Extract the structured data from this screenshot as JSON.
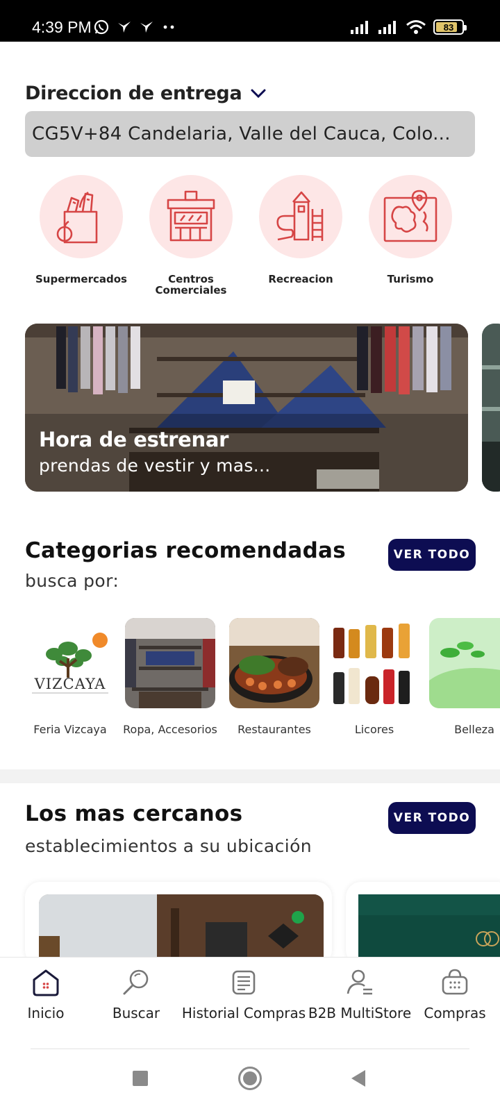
{
  "status_bar": {
    "time": "4:39 PM",
    "battery": "83",
    "icons": [
      "whatsapp-icon",
      "bird-icon",
      "bird-icon",
      "dots-icon",
      "signal-icon",
      "signal-icon",
      "wifi-icon",
      "battery-icon"
    ]
  },
  "delivery": {
    "title": "Direccion de entrega",
    "address": "CG5V+84 Candelaria, Valle del Cauca, Colo..."
  },
  "quick_categories": [
    {
      "label": "Supermercados",
      "icon": "grocery-bag-icon"
    },
    {
      "label": "Centros Comerciales",
      "icon": "storefront-icon"
    },
    {
      "label": "Recreacion",
      "icon": "playground-icon"
    },
    {
      "label": "Turismo",
      "icon": "map-pin-icon"
    }
  ],
  "banner": {
    "title": "Hora de estrenar",
    "subtitle": "prendas de vestir y mas..."
  },
  "recommended": {
    "title": "Categorias recomendadas",
    "subtitle": "busca por:",
    "button": "VER TODO",
    "logo_text": "VIZCAYA",
    "items": [
      {
        "label": "Feria Vizcaya"
      },
      {
        "label": "Ropa, Accesorios"
      },
      {
        "label": "Restaurantes"
      },
      {
        "label": "Licores"
      },
      {
        "label": "Belleza"
      }
    ]
  },
  "nearby": {
    "title": "Los mas cercanos",
    "subtitle": "establecimientos a su ubicación",
    "button": "VER TODO"
  },
  "bottom_nav": [
    {
      "label": "Inicio",
      "icon": "home-icon"
    },
    {
      "label": "Buscar",
      "icon": "search-icon"
    },
    {
      "label": "Historial Compras",
      "icon": "receipt-icon"
    },
    {
      "label": "B2B MultiStore",
      "icon": "user-list-icon"
    },
    {
      "label": "Compras",
      "icon": "basket-icon"
    }
  ],
  "colors": {
    "accent": "#d64545",
    "accent_soft": "#fde6e6",
    "button_navy": "#0d0d52",
    "address_box": "#cfcfcf"
  }
}
